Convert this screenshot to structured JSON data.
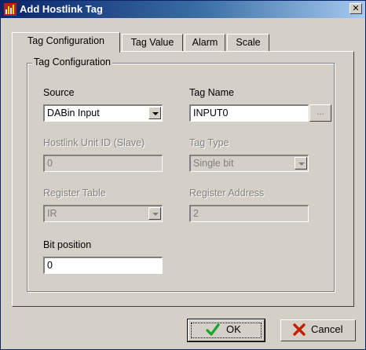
{
  "window": {
    "title": "Add Hostlink Tag",
    "close_glyph": "✕"
  },
  "tabs": [
    {
      "label": "Tag Configuration",
      "active": true
    },
    {
      "label": "Tag Value",
      "active": false
    },
    {
      "label": "Alarm",
      "active": false
    },
    {
      "label": "Scale",
      "active": false
    }
  ],
  "group": {
    "title": "Tag Configuration"
  },
  "form": {
    "source": {
      "label": "Source",
      "value": "DABin Input"
    },
    "tag_name": {
      "label": "Tag Name",
      "value": "INPUT0",
      "browse": "..."
    },
    "hostlink_unit_id": {
      "label": "Hostlink Unit ID (Slave)",
      "value": "0"
    },
    "tag_type": {
      "label": "Tag Type",
      "value": "Single bit"
    },
    "register_table": {
      "label": "Register Table",
      "value": "IR"
    },
    "register_address": {
      "label": "Register Address",
      "value": "2"
    },
    "bit_position": {
      "label": "Bit position",
      "value": "0"
    }
  },
  "buttons": {
    "ok": "OK",
    "cancel": "Cancel"
  },
  "icons": {
    "app": "bar-chart-icon",
    "ok": "check-icon",
    "cancel": "x-icon"
  },
  "colors": {
    "titlebar_start": "#0a246a",
    "titlebar_end": "#a6caf0",
    "face": "#d4d0c8",
    "check": "#1aa32a",
    "cross": "#c81e00"
  }
}
